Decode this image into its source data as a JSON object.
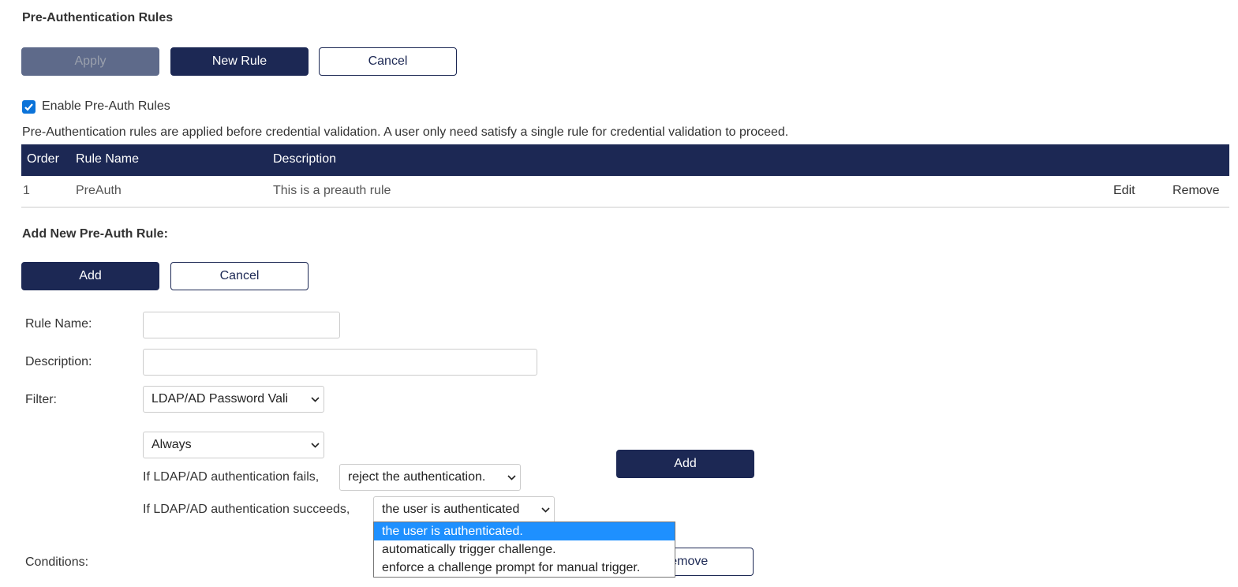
{
  "page": {
    "title": "Pre-Authentication Rules"
  },
  "toolbar": {
    "apply_label": "Apply",
    "new_rule_label": "New Rule",
    "cancel_label": "Cancel"
  },
  "enable": {
    "label": "Enable Pre-Auth Rules",
    "checked": true
  },
  "info_text": "Pre-Authentication rules are applied before credential validation. A user only need satisfy a single rule for credential validation to proceed.",
  "table": {
    "columns": [
      "Order",
      "Rule Name",
      "Description"
    ],
    "rows": [
      {
        "order": "1",
        "rule_name": "PreAuth",
        "description": "This is a preauth rule",
        "edit_label": "Edit",
        "remove_label": "Remove"
      }
    ]
  },
  "add_rule": {
    "title": "Add New Pre-Auth Rule:",
    "add_label": "Add",
    "cancel_label": "Cancel",
    "fields": {
      "rule_name_label": "Rule Name:",
      "rule_name_value": "",
      "description_label": "Description:",
      "description_value": "",
      "filter_label": "Filter:",
      "filter_value": "LDAP/AD Password Vali",
      "condition_value": "Always",
      "fail_text": "If LDAP/AD authentication fails,",
      "fail_value": "reject the authentication.",
      "success_text": "If LDAP/AD authentication succeeds,",
      "success_value": "the user is authenticated",
      "conditions_label": "Conditions:"
    },
    "filter_add_label": "Add",
    "remove_label": "Remove",
    "success_options": [
      "the user is authenticated.",
      "automatically trigger challenge.",
      "enforce a challenge prompt for manual trigger."
    ],
    "success_selected_index": 0
  },
  "colors": {
    "primary": "#1c2854",
    "disabled": "#5e6a8a",
    "highlight": "#1e90ff",
    "checkbox": "#0b73d9"
  }
}
